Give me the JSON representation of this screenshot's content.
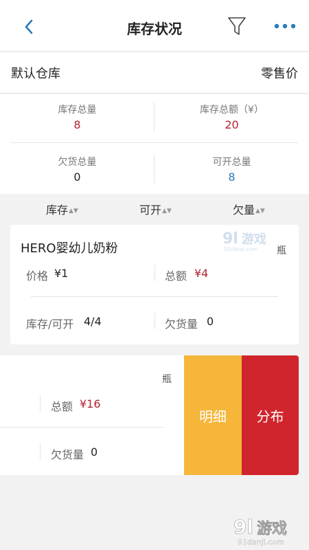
{
  "header": {
    "title": "库存状况",
    "back_icon": "chevron-left-icon",
    "filter_icon": "filter-icon",
    "more_icon": "more-dots-icon",
    "accent_color": "#2a7ab8"
  },
  "warehouse": {
    "name": "默认仓库",
    "price_type": "零售价"
  },
  "summary": {
    "total_stock": {
      "label": "库存总量",
      "value": "8"
    },
    "total_amount": {
      "label": "库存总额（¥）",
      "value": "20"
    },
    "total_owed": {
      "label": "欠货总量",
      "value": "0"
    },
    "available_total": {
      "label": "可开总量",
      "value": "8"
    }
  },
  "sort": {
    "stock": "库存",
    "available": "可开",
    "owed": "欠量",
    "arrows": "▲▼"
  },
  "products": [
    {
      "name": "HERO婴幼儿奶粉",
      "unit": "瓶",
      "price_label": "价格",
      "price_value": "¥1",
      "amount_label": "总额",
      "amount_value": "¥4",
      "stock_label": "库存/可开",
      "stock_value": "4/4",
      "owed_label": "欠货量",
      "owed_value": "0"
    },
    {
      "unit": "瓶",
      "amount_label": "总额",
      "amount_value": "¥16",
      "owed_label": "欠货量",
      "owed_value": "0",
      "actions": {
        "detail": "明细",
        "distribution": "分布",
        "detail_color": "#f5b63a",
        "distribution_color": "#d0252d"
      }
    }
  ],
  "watermark": {
    "brand": "91游戏",
    "site": "91danji.com"
  }
}
